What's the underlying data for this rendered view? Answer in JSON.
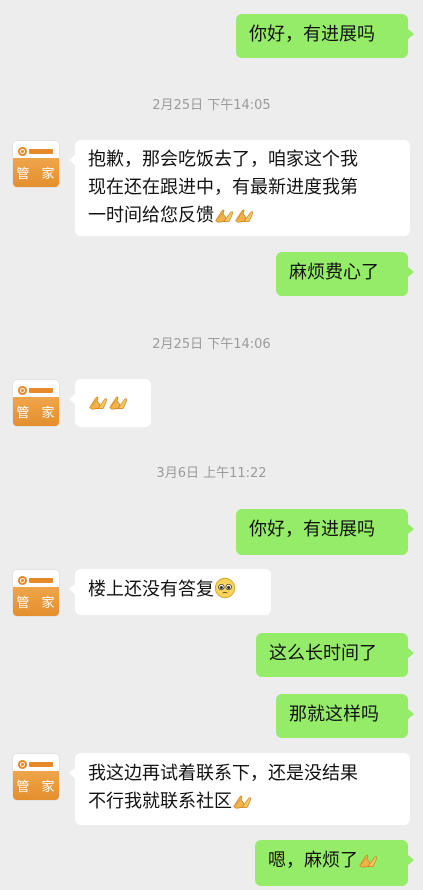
{
  "colors": {
    "outgoing": "#95ec69",
    "incoming": "#ffffff",
    "background": "#ededed",
    "avatar": "#e38f2e"
  },
  "contact": {
    "avatar_label": "管 家"
  },
  "messages": {
    "m1": "你好，有进展吗",
    "t1": "2月25日 下午14:05",
    "m2_line1": "抱歉，那会吃饭去了，咱家这个我",
    "m2_line2": "现在还在跟进中，有最新进度我第",
    "m2_line3": "一时间给您反馈",
    "m3": "麻烦费心了",
    "t2": "2月25日 下午14:06",
    "t3": "3月6日 上午11:22",
    "m5": "你好，有进展吗",
    "m6": "楼上还没有答复",
    "m7": "这么长时间了",
    "m8": "那就这样吗",
    "m9_line1": "我这边再试着联系下，还是没结果",
    "m9_line2": "不行我就联系社区",
    "m10": "嗯，麻烦了"
  },
  "icons": {
    "pray": "folded-hands-icon",
    "face": "pleading-face-icon"
  }
}
